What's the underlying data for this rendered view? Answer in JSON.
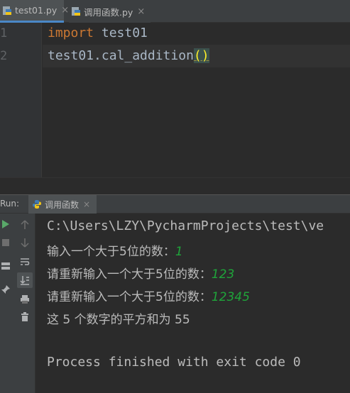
{
  "editor": {
    "tabs": [
      {
        "label": "test01.py",
        "active": true
      },
      {
        "label": "调用函数.py",
        "active": false
      }
    ],
    "line_numbers": [
      "1",
      "2"
    ],
    "lines": [
      {
        "keyword": "import",
        "rest": " test01"
      },
      {
        "text": "test01.cal_addition",
        "parens": "()"
      }
    ]
  },
  "run": {
    "label": "Run:",
    "config_tab": "调用函数",
    "close_glyph": "×"
  },
  "console": {
    "lines": [
      {
        "text": "C:\\Users\\LZY\\PycharmProjects\\test\\ve"
      },
      {
        "prompt": "输入一个大于5位的数：",
        "input": "1"
      },
      {
        "prompt": "请重新输入一个大于5位的数：",
        "input": "123"
      },
      {
        "prompt": "请重新输入一个大于5位的数：",
        "input": "12345"
      },
      {
        "text": "这 5 个数字的平方和为 55"
      },
      {
        "text": ""
      },
      {
        "text": "Process finished with exit code 0"
      }
    ]
  },
  "colors": {
    "keyword": "#cc7832",
    "identifier": "#a9b7c6",
    "console_input": "#1fa43a",
    "background": "#2b2b2b"
  },
  "icons": [
    "python-file-icon",
    "close-icon",
    "run-icon",
    "stop-icon",
    "up-arrow-icon",
    "down-arrow-icon",
    "soft-wrap-icon",
    "scroll-to-end-icon",
    "print-icon",
    "trash-icon",
    "layout-icon",
    "pin-icon"
  ]
}
